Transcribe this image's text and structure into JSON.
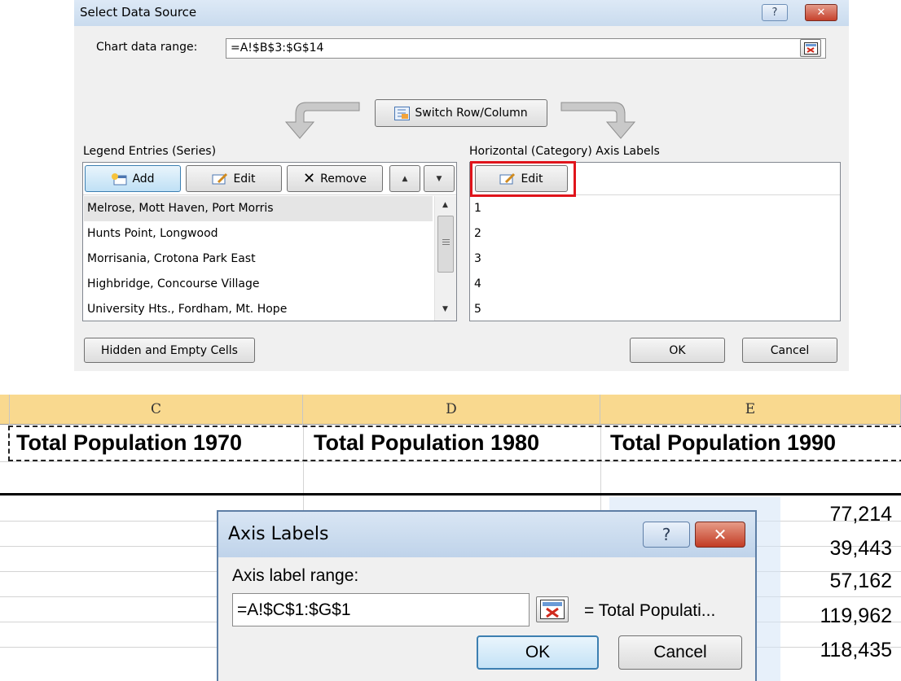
{
  "select_data_source": {
    "title": "Select Data Source",
    "help_button": "?",
    "close_button": "✕",
    "chart_range_label": "Chart data range:",
    "chart_range_value": "=A!$B$3:$G$14",
    "switch_button": "Switch Row/Column",
    "legend_label": "Legend Entries (Series)",
    "axis_labels_label": "Horizontal (Category) Axis Labels",
    "add_button": "Add",
    "edit_button": "Edit",
    "remove_button": "Remove",
    "axis_edit_button": "Edit",
    "series": [
      "Melrose, Mott Haven, Port Morris",
      "Hunts Point, Longwood",
      "Morrisania, Crotona Park East",
      "Highbridge, Concourse Village",
      "University Hts., Fordham, Mt. Hope"
    ],
    "categories": [
      "1",
      "2",
      "3",
      "4",
      "5"
    ],
    "hidden_cells_button": "Hidden and Empty Cells",
    "ok_button": "OK",
    "cancel_button": "Cancel"
  },
  "sheet": {
    "columns": [
      "C",
      "D",
      "E"
    ],
    "headers": [
      "Total Population 1970",
      "Total Population 1980",
      "Total Population 1990"
    ],
    "values_e": [
      "77,214",
      "39,443",
      "57,162",
      "119,962",
      "118,435"
    ],
    "accent_header_color": "#f9d98f"
  },
  "axis_labels_dialog": {
    "title": "Axis Labels",
    "help_button": "?",
    "close_button": "✕",
    "range_label": "Axis label range:",
    "range_value": "=A!$C$1:$G$1",
    "preview": "= Total Populati...",
    "ok_button": "OK",
    "cancel_button": "Cancel"
  }
}
